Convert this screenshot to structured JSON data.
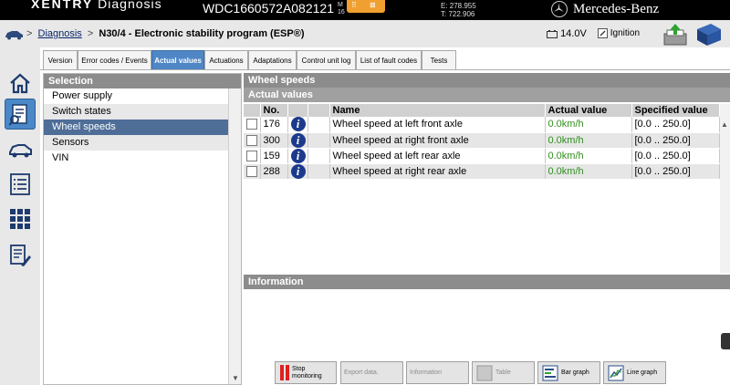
{
  "topbar": {
    "brand_prefix": "XENTRY",
    "brand_suffix": "Diagnosis",
    "vin": "WDC1660572A082121",
    "mini_line1": "M",
    "mini_line2": "16",
    "coord_e": "E: 278.955",
    "coord_t": "T: 722.906",
    "brand_logo_text": "Mercedes-Benz"
  },
  "header": {
    "breadcrumb_root": "Diagnosis",
    "breadcrumb_sep": ">",
    "breadcrumb_current": "N30/4 - Electronic stability program (ESP®)",
    "battery_voltage": "14.0V",
    "ignition_label": "Ignition"
  },
  "tabs": [
    {
      "label": "Version"
    },
    {
      "label": "Error codes / Events"
    },
    {
      "label": "Actual values"
    },
    {
      "label": "Actuations"
    },
    {
      "label": "Adaptations"
    },
    {
      "label": "Control unit log"
    },
    {
      "label": "List of fault codes"
    },
    {
      "label": "Tests"
    }
  ],
  "selection": {
    "title": "Selection",
    "items": [
      {
        "label": "Power supply"
      },
      {
        "label": "Switch states"
      },
      {
        "label": "Wheel speeds"
      },
      {
        "label": "Sensors"
      },
      {
        "label": "VIN"
      }
    ]
  },
  "main": {
    "section_title": "Wheel speeds",
    "sub_title": "Actual values",
    "columns": {
      "no": "No.",
      "name": "Name",
      "actual": "Actual value",
      "specified": "Specified value"
    },
    "rows": [
      {
        "no": "176",
        "name": "Wheel speed at left front axle",
        "actual": "0.0km/h",
        "specified": "[0.0 .. 250.0]"
      },
      {
        "no": "300",
        "name": "Wheel speed at right front axle",
        "actual": "0.0km/h",
        "specified": "[0.0 .. 250.0]"
      },
      {
        "no": "159",
        "name": "Wheel speed at left rear axle",
        "actual": "0.0km/h",
        "specified": "[0.0 .. 250.0]"
      },
      {
        "no": "288",
        "name": "Wheel speed at right rear axle",
        "actual": "0.0km/h",
        "specified": "[0.0 .. 250.0]"
      }
    ],
    "info_title": "Information"
  },
  "toolbar": {
    "stop_line1": "Stop",
    "stop_line2": "monitoring",
    "export": "Export data.",
    "information": "Information",
    "table": "Table",
    "bar_graph": "Bar graph",
    "line_graph": "Line graph"
  },
  "colors": {
    "active_tab": "#4f86c6",
    "selected_item": "#4e6e98",
    "actual_value": "#2f8f1e",
    "section_header": "#8c8c8c"
  }
}
